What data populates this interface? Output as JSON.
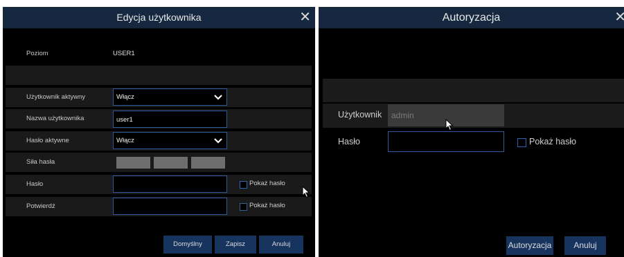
{
  "user_edit_dialog": {
    "title": "Edycja użytkownika",
    "close_glyph": "✕",
    "level": {
      "label": "Poziom",
      "value": "USER1"
    },
    "user_active": {
      "label": "Użytkownik aktywny",
      "value": "Włącz"
    },
    "username": {
      "label": "Nazwa użytkownika",
      "value": "user1"
    },
    "password_active": {
      "label": "Hasło aktywne",
      "value": "Włącz"
    },
    "password_strength": {
      "label": "Siła hasła",
      "segments": 3,
      "filled": 0
    },
    "password": {
      "label": "Hasło",
      "value": "",
      "show_password_label": "Pokaż hasło",
      "show_password_checked": false
    },
    "confirm": {
      "label": "Potwierdź",
      "value": "",
      "show_password_label": "Pokaż hasło",
      "show_password_checked": false
    },
    "buttons": {
      "default": "Domyślny",
      "save": "Zapisz",
      "cancel": "Anuluj"
    },
    "colors": {
      "title_bar": "#16283f",
      "button": "#17345f",
      "input_border": "#2e5a9c",
      "shaded_row": "#1a1a1a"
    }
  },
  "auth_dialog": {
    "title": "Autoryzacja",
    "close_glyph": "✕",
    "username": {
      "label": "Użytkownik",
      "placeholder": "admin",
      "value": ""
    },
    "password": {
      "label": "Hasło",
      "value": "",
      "show_password_label": "Pokaż hasło",
      "show_password_checked": false
    },
    "buttons": {
      "authorize": "Autoryzacja",
      "cancel": "Anuluj"
    }
  }
}
